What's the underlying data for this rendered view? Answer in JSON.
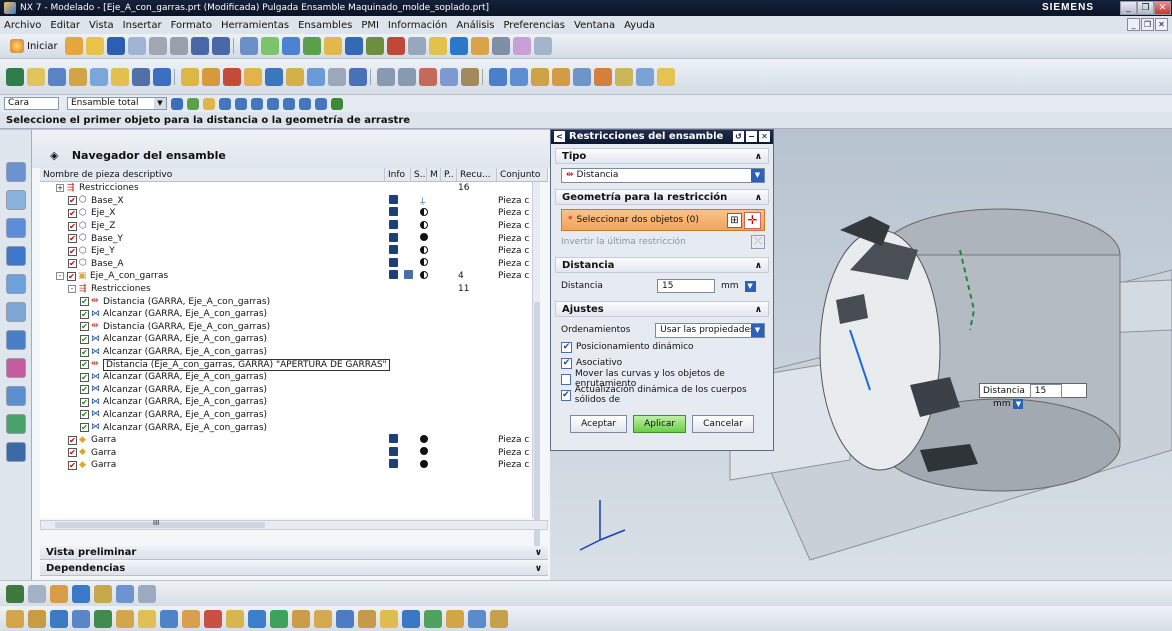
{
  "window": {
    "title": "NX 7 - Modelado - [Eje_A_con_garras.prt (Modificada)  Pulgada Ensamble Maquinado_molde_soplado.prt]",
    "brand": "SIEMENS"
  },
  "menu": [
    "Archivo",
    "Editar",
    "Vista",
    "Insertar",
    "Formato",
    "Herramientas",
    "Ensambles",
    "PMI",
    "Información",
    "Análisis",
    "Preferencias",
    "Ventana",
    "Ayuda"
  ],
  "toolbar": {
    "start_label": "Iniciar"
  },
  "selection_bar": {
    "filter": "Cara",
    "scope": "Ensamble total"
  },
  "cue_line": "Seleccione el primer objeto para la distancia o la geometría de arrastre",
  "navigator": {
    "title": "Navegador del ensamble",
    "columns": [
      "Nombre de pieza descriptivo",
      "Info",
      "S..",
      "M",
      "P..",
      "Recu...",
      "Conjunto"
    ],
    "rows": [
      {
        "indent": 1,
        "expander": "+",
        "icon": "constraint-icon",
        "name": "Restricciones",
        "recu": "16"
      },
      {
        "indent": 2,
        "check": true,
        "icon": "part-icon",
        "name": "Base_X",
        "info": "disk",
        "p": "pin",
        "conj": "Pieza c"
      },
      {
        "indent": 2,
        "check": true,
        "icon": "part-icon",
        "name": "Eje_X",
        "info": "disk",
        "p": "half",
        "conj": "Pieza c"
      },
      {
        "indent": 2,
        "check": true,
        "icon": "part-icon",
        "name": "Eje_Z",
        "info": "disk",
        "p": "half",
        "conj": "Pieza c"
      },
      {
        "indent": 2,
        "check": true,
        "icon": "part-icon",
        "name": "Base_Y",
        "info": "disk",
        "p": "dot",
        "conj": "Pieza c"
      },
      {
        "indent": 2,
        "check": true,
        "icon": "part-icon",
        "name": "Eje_Y",
        "info": "disk",
        "p": "half",
        "conj": "Pieza c"
      },
      {
        "indent": 2,
        "check": true,
        "icon": "part-icon",
        "name": "Base_A",
        "info": "disk",
        "p": "half",
        "conj": "Pieza c"
      },
      {
        "indent": 1,
        "expander": "-",
        "check": true,
        "icon": "subassembly-icon",
        "name": "Eje_A_con_garras",
        "info": "disk",
        "s": "doc",
        "p": "half",
        "recu": "4",
        "conj": "Pieza c"
      },
      {
        "indent": 2,
        "expander": "-",
        "icon": "constraint-icon",
        "name": "Restricciones",
        "recu": "11"
      },
      {
        "indent": 3,
        "check": true,
        "icon": "distance-icon",
        "name": "Distancia (GARRA, Eje_A_con_garras)"
      },
      {
        "indent": 3,
        "check": true,
        "icon": "touch-align-icon",
        "name": "Alcanzar (GARRA, Eje_A_con_garras)"
      },
      {
        "indent": 3,
        "check": true,
        "icon": "distance-icon",
        "name": "Distancia (GARRA, Eje_A_con_garras)"
      },
      {
        "indent": 3,
        "check": true,
        "icon": "touch-align-icon",
        "name": "Alcanzar (GARRA, Eje_A_con_garras)"
      },
      {
        "indent": 3,
        "check": true,
        "icon": "touch-align-icon",
        "name": "Alcanzar (GARRA, Eje_A_con_garras)"
      },
      {
        "indent": 3,
        "check": true,
        "icon": "distance-icon",
        "name": "Distancia (Eje_A_con_garras, GARRA) \"APERTURA DE GARRAS\"",
        "boxed": true
      },
      {
        "indent": 3,
        "check": true,
        "icon": "touch-align-icon",
        "name": "Alcanzar (GARRA, Eje_A_con_garras)"
      },
      {
        "indent": 3,
        "check": true,
        "icon": "touch-align-icon",
        "name": "Alcanzar (GARRA, Eje_A_con_garras)"
      },
      {
        "indent": 3,
        "check": true,
        "icon": "touch-align-icon",
        "name": "Alcanzar (GARRA, Eje_A_con_garras)"
      },
      {
        "indent": 3,
        "check": true,
        "icon": "touch-align-icon",
        "name": "Alcanzar (GARRA, Eje_A_con_garras)"
      },
      {
        "indent": 3,
        "check": true,
        "icon": "touch-align-icon",
        "name": "Alcanzar (GARRA, Eje_A_con_garras)"
      },
      {
        "indent": 2,
        "check": true,
        "icon": "component-icon",
        "name": "Garra",
        "info": "disk",
        "p": "dot",
        "conj": "Pieza c"
      },
      {
        "indent": 2,
        "check": true,
        "icon": "component-icon",
        "name": "Garra",
        "info": "disk",
        "p": "dot",
        "conj": "Pieza c"
      },
      {
        "indent": 2,
        "check": true,
        "icon": "component-icon",
        "name": "Garra",
        "info": "disk",
        "p": "dot",
        "conj": "Pieza c"
      }
    ],
    "preview_label": "Vista preliminar",
    "dependencies_label": "Dependencias",
    "scroll_mark": "III"
  },
  "dialog": {
    "title": "Restricciones del ensamble",
    "tipo": {
      "header": "Tipo",
      "value": "Distancia"
    },
    "geometry": {
      "header": "Geometría para la restricción",
      "select": "Seleccionar dos objetos (0)",
      "invert": "Invertir la última restricción"
    },
    "distance": {
      "header": "Distancia",
      "label": "Distancia",
      "value": "15",
      "unit": "mm"
    },
    "settings": {
      "header": "Ajustes",
      "arrange_label": "Ordenamientos",
      "arrange_value": "Usar las propiedades c",
      "options": [
        {
          "label": "Posicionamiento dinámico",
          "checked": true
        },
        {
          "label": "Asociativo",
          "checked": true
        },
        {
          "label": "Mover las curvas y los objetos de enrutamiento",
          "checked": false
        },
        {
          "label": "Actualización dinámica de los cuerpos sólidos de",
          "checked": true
        }
      ]
    },
    "buttons": {
      "ok": "Aceptar",
      "apply": "Aplicar",
      "cancel": "Cancelar"
    }
  },
  "viewport_tip": {
    "label": "Distancia",
    "value": "15",
    "unit": "mm"
  },
  "colors": {
    "title_bar": "#0b1426",
    "accent_orange": "#f1a45b",
    "apply_green": "#6cce48",
    "dialog_title": "#0c1830"
  }
}
